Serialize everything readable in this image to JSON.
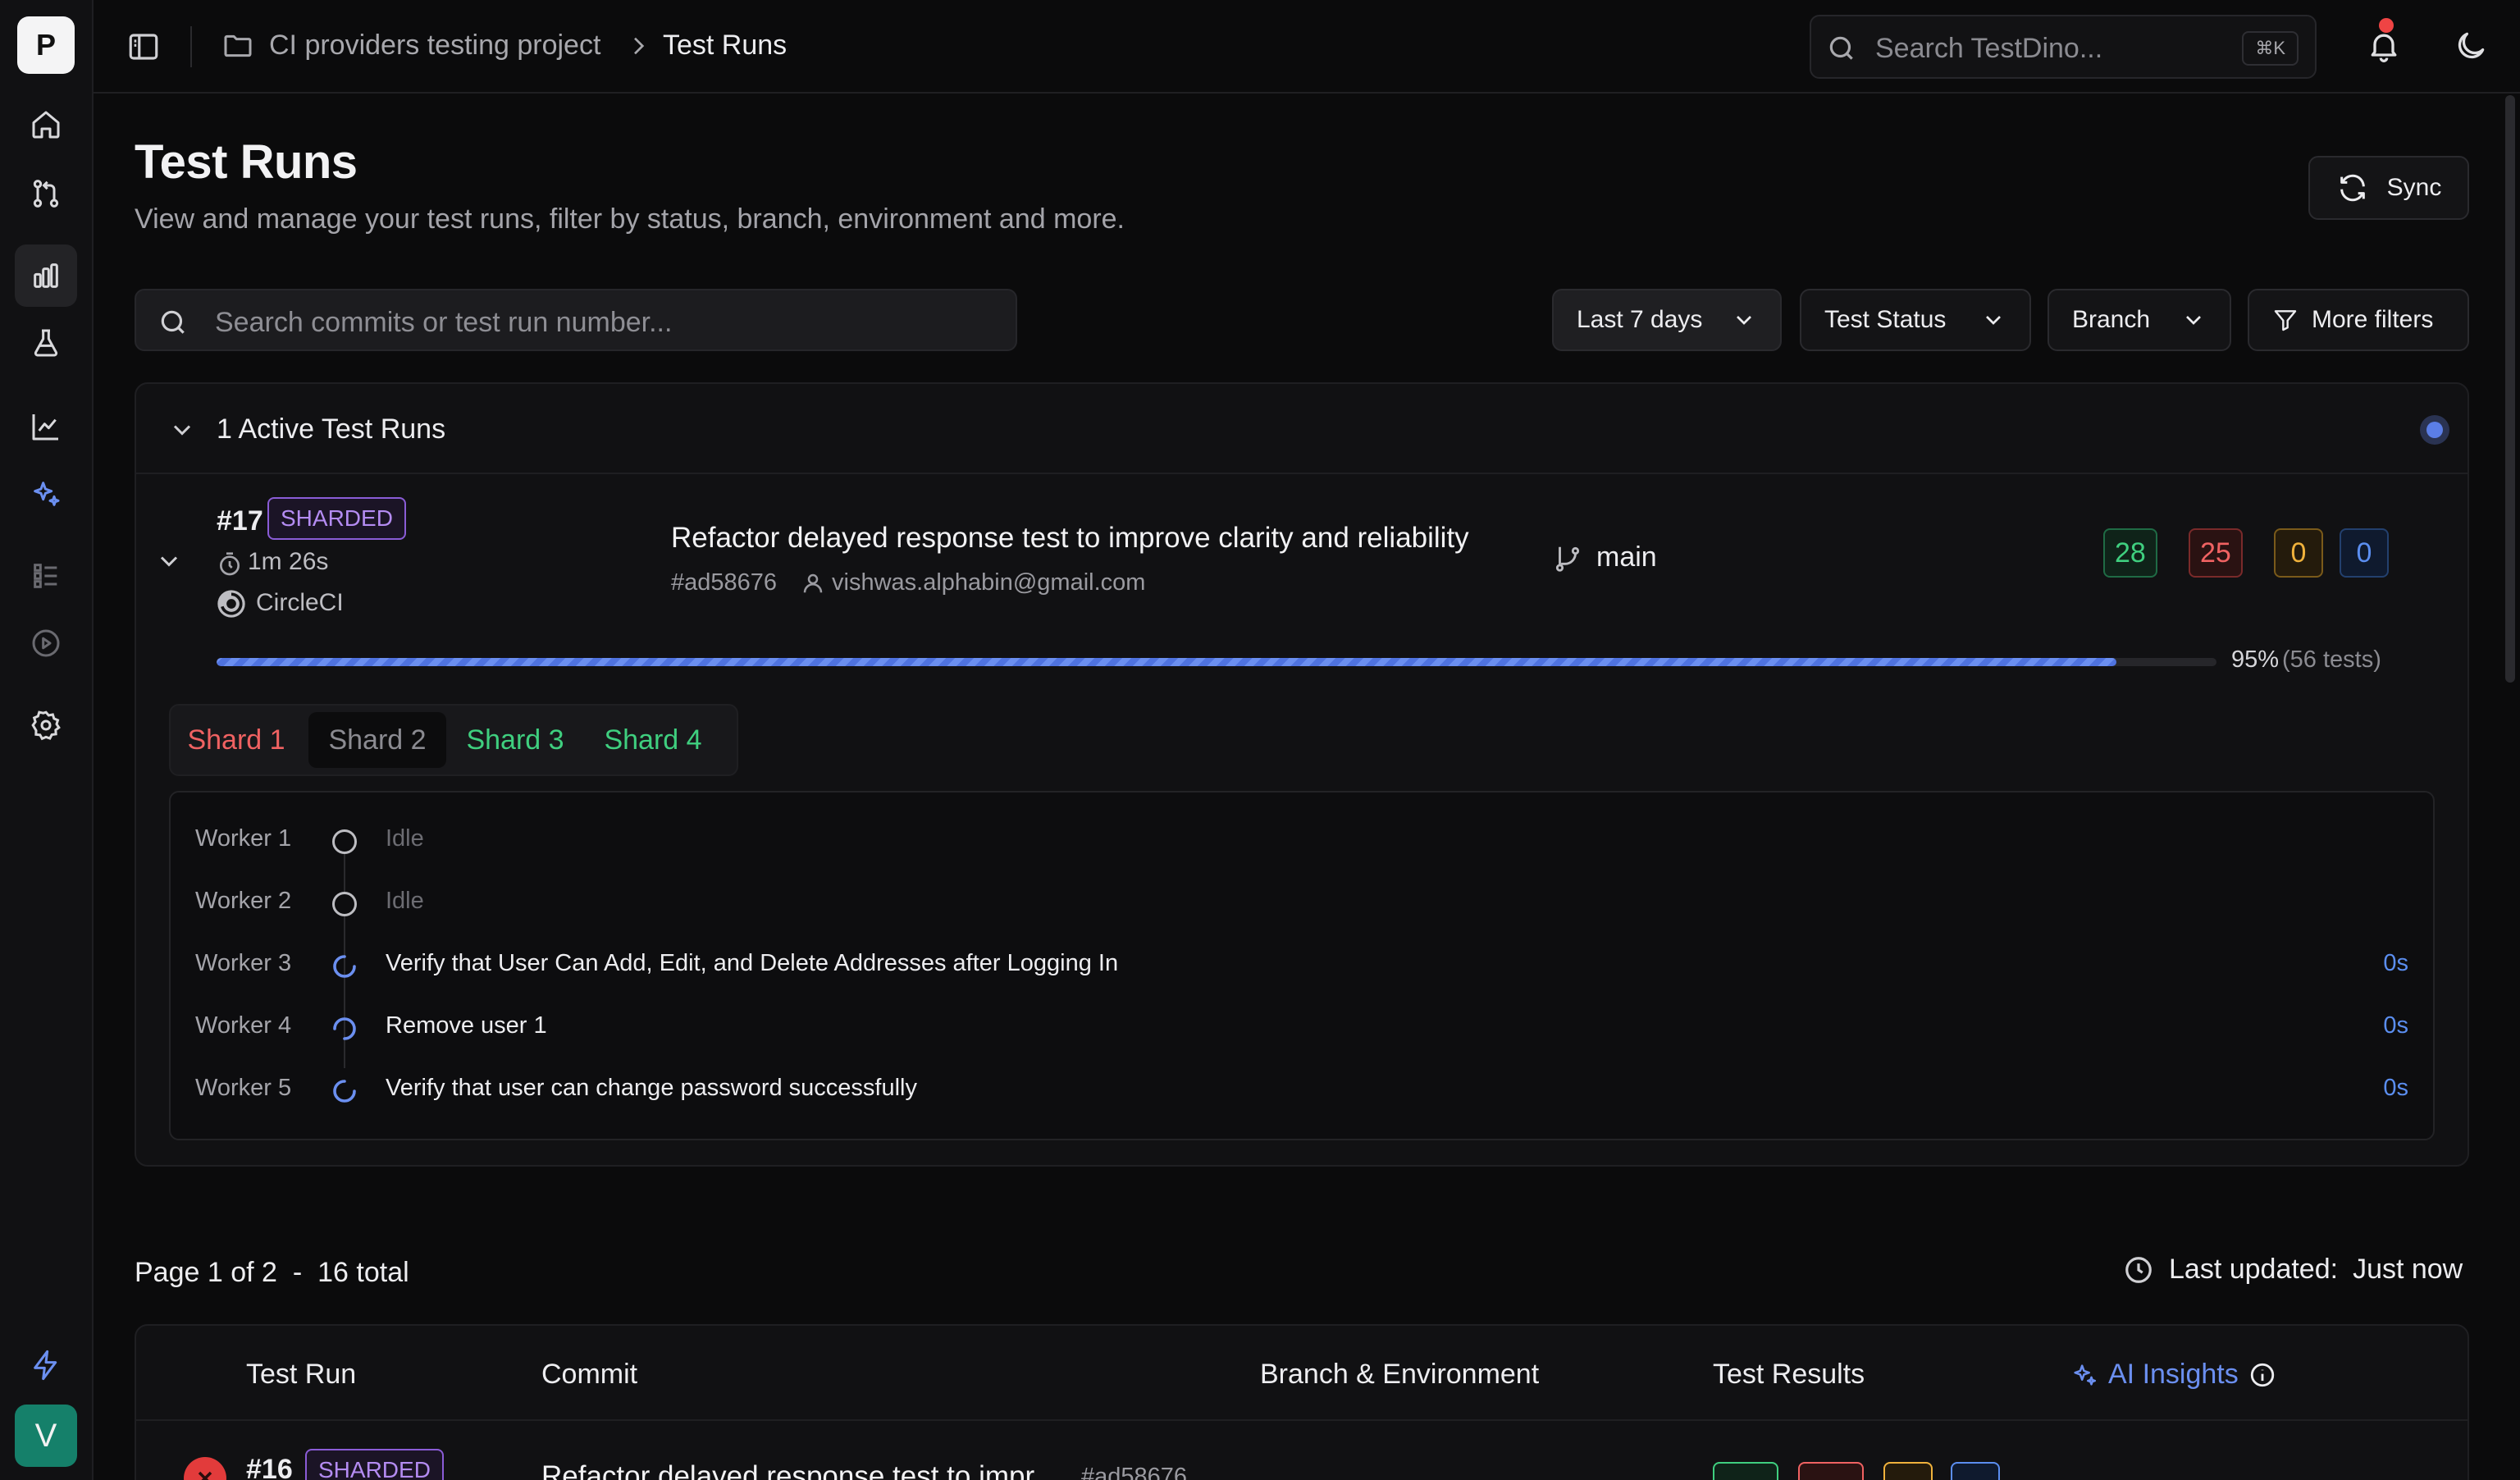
{
  "app": {
    "logo_letter": "P",
    "avatar_letter": "V"
  },
  "breadcrumb": {
    "project": "CI providers testing project",
    "current": "Test Runs"
  },
  "search": {
    "placeholder": "Search TestDino...",
    "shortcut": "⌘K"
  },
  "header": {
    "title": "Test Runs",
    "subtitle": "View and manage your test runs, filter by status, branch, environment and more.",
    "sync_label": "Sync"
  },
  "filters": {
    "search_placeholder": "Search commits or test run number...",
    "date_range": "Last 7 days",
    "status": "Test Status",
    "branch": "Branch",
    "more": "More filters"
  },
  "active": {
    "heading": "1 Active Test Runs",
    "run": {
      "number": "#17",
      "badge": "SHARDED",
      "duration": "1m 26s",
      "ci": "CircleCI",
      "commit_message": "Refactor delayed response test to improve clarity and reliability",
      "commit_hash": "#ad58676",
      "author": "vishwas.alphabin@gmail.com",
      "branch": "main",
      "counts": {
        "passed": "28",
        "failed": "25",
        "skipped": "0",
        "flaky": "0"
      },
      "progress": 0.95,
      "progress_pct": "95%",
      "progress_tests": "(56 tests)"
    },
    "shards": [
      {
        "label": "Shard 1",
        "status": "failed"
      },
      {
        "label": "Shard 2",
        "status": "running"
      },
      {
        "label": "Shard 3",
        "status": "passed"
      },
      {
        "label": "Shard 4",
        "status": "passed"
      }
    ],
    "selected_shard": "Shard 2",
    "workers": [
      {
        "name": "Worker 1",
        "state": "idle",
        "text": "Idle",
        "time": ""
      },
      {
        "name": "Worker 2",
        "state": "idle",
        "text": "Idle",
        "time": ""
      },
      {
        "name": "Worker 3",
        "state": "running",
        "text": "Verify that User Can Add, Edit, and Delete Addresses after Logging In",
        "time": "0s"
      },
      {
        "name": "Worker 4",
        "state": "running",
        "text": "Remove user 1",
        "time": "0s"
      },
      {
        "name": "Worker 5",
        "state": "running",
        "text": "Verify that user can change password successfully",
        "time": "0s"
      }
    ]
  },
  "pagination": {
    "page_word": "Page",
    "page": "1",
    "of_word": "of",
    "pages": "2",
    "dash": "-",
    "total": "16",
    "total_word": "total",
    "updated_label": "Last updated:",
    "updated_value": "Just now"
  },
  "table": {
    "columns": [
      "Test Run",
      "Commit",
      "Branch & Environment",
      "Test Results",
      "AI Insights"
    ],
    "rows": [
      {
        "number": "#16",
        "badge": "SHARDED",
        "status": "failed",
        "commit": "Refactor delayed response test to impr...",
        "hash": "#ad58676"
      }
    ]
  },
  "colors": {
    "accent": "#6b8ff0",
    "passed": "#3fcf7f",
    "failed": "#f06262",
    "skipped": "#f0b23c",
    "sharded": "#b48cf2"
  }
}
